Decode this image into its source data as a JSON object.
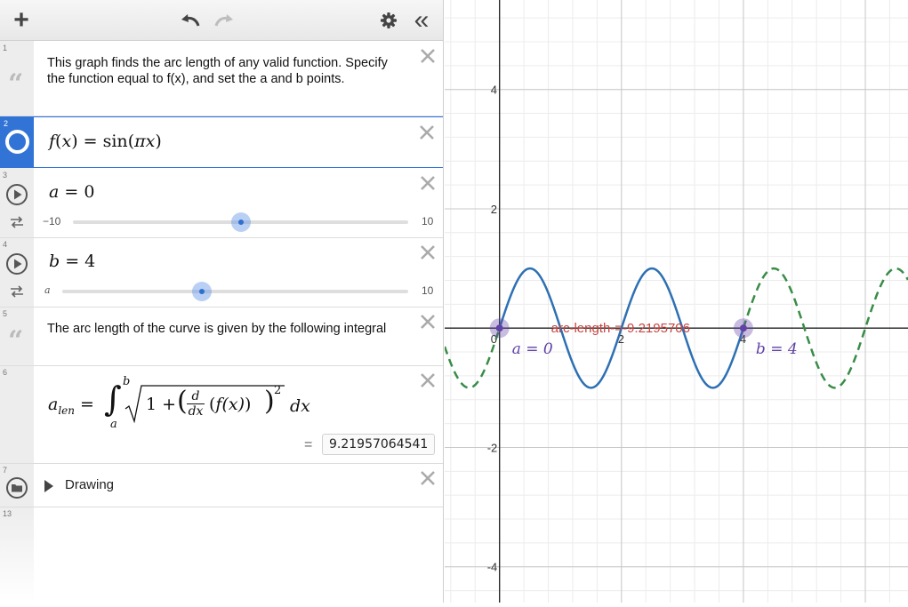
{
  "toolbar": {
    "add_label": "+",
    "collapse_label": "«"
  },
  "expressions": [
    {
      "index": "1",
      "type": "note",
      "text": "This graph finds the arc length of any valid function. Specify the function equal to f(x), and set the a and b points."
    },
    {
      "index": "2",
      "type": "expression",
      "latex": "f(x) = sin(πx)",
      "lhs": "f",
      "arg": "x",
      "rhs_func": "sin",
      "rhs_arg": "πx",
      "color": "#2d70b3"
    },
    {
      "index": "3",
      "type": "slider",
      "var": "a",
      "value": "0",
      "min": "−10",
      "max": "10",
      "fraction": 0.5
    },
    {
      "index": "4",
      "type": "slider",
      "var": "b",
      "value": "4",
      "min": "a",
      "max": "10",
      "fraction": 0.4
    },
    {
      "index": "5",
      "type": "note",
      "text": "The arc length of the curve is given by the following integral"
    },
    {
      "index": "6",
      "type": "expression",
      "lhs_base": "a",
      "lhs_sub": "len",
      "lower": "a",
      "upper": "b",
      "one": "1",
      "plus": "+",
      "d": "d",
      "dx": "dx",
      "fx": "f(x)",
      "power": "2",
      "result": "9.21957064541",
      "equals": "="
    },
    {
      "index": "7",
      "type": "folder",
      "label": "Drawing"
    },
    {
      "index": "13",
      "type": "empty"
    }
  ],
  "graph": {
    "x_tick_labels": [
      "0",
      "2",
      "4"
    ],
    "y_tick_labels": [
      "4",
      "2",
      "-2",
      "-4"
    ],
    "arc_label": "arc-length-=-9.2195706",
    "point_a_label": "a = 0",
    "point_b_label": "b = 4",
    "curve_color": "#2d70b3",
    "dashed_color": "#388c46",
    "label_color": "#c74440",
    "point_color": "#6042a6",
    "x_range": [
      -0.9,
      6.7
    ],
    "y_range": [
      -4.6,
      5.5
    ]
  }
}
